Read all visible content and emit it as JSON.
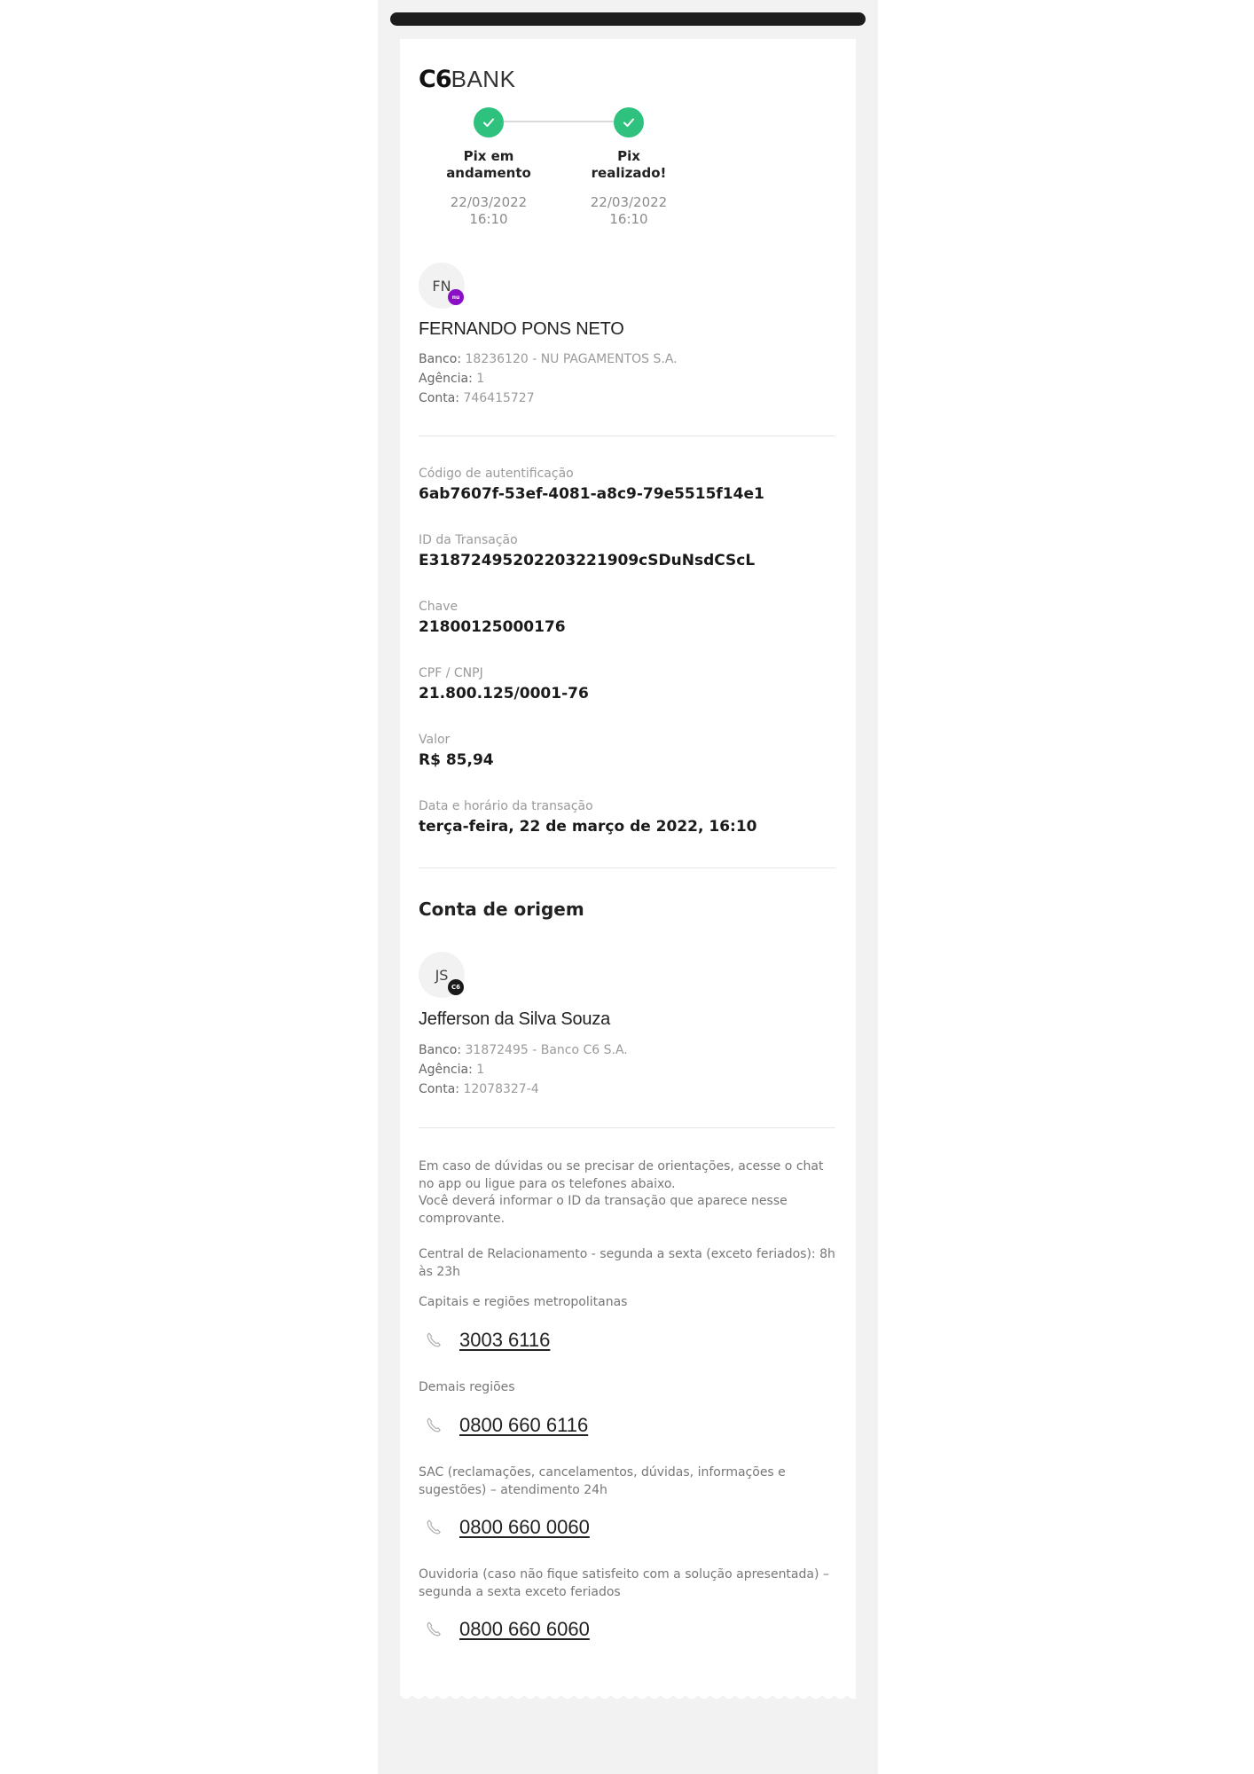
{
  "brand": {
    "mark": "C6",
    "word": "BANK"
  },
  "steps": [
    {
      "title": "Pix em\nandamento",
      "date": "22/03/2022\n16:10"
    },
    {
      "title": "Pix\nrealizado!",
      "date": "22/03/2022\n16:10"
    }
  ],
  "recipient": {
    "initials": "FN",
    "badge": "nu",
    "name": "FERNANDO PONS NETO",
    "banco_label": "Banco:",
    "banco": "18236120 - NU PAGAMENTOS S.A.",
    "agencia_label": "Agência:",
    "agencia": "1",
    "conta_label": "Conta:",
    "conta": "746415727"
  },
  "details": [
    {
      "label": "Código de autentificação",
      "value": "6ab7607f-53ef-4081-a8c9-79e5515f14e1"
    },
    {
      "label": "ID da Transação",
      "value": "E31872495202203221909cSDuNsdCScL"
    },
    {
      "label": "Chave",
      "value": "21800125000176"
    },
    {
      "label": "CPF / CNPJ",
      "value": "21.800.125/0001-76"
    },
    {
      "label": "Valor",
      "value": "R$ 85,94"
    },
    {
      "label": "Data e horário da transação",
      "value": "terça-feira, 22 de março de 2022, 16:10"
    }
  ],
  "origin": {
    "section_title": "Conta de origem",
    "initials": "JS",
    "badge": "C6",
    "name": "Jefferson da Silva Souza",
    "banco_label": "Banco:",
    "banco": "31872495 - Banco C6 S.A.",
    "agencia_label": "Agência:",
    "agencia": "1",
    "conta_label": "Conta:",
    "conta": "12078327-4"
  },
  "help": {
    "intro": "Em caso de dúvidas ou se precisar de orientações, acesse o chat no app ou ligue para os telefones abaixo.\nVocê deverá informar o ID da transação que aparece nesse comprovante.",
    "central": "Central de Relacionamento - segunda a sexta (exceto feriados): 8h às 23h",
    "phones": [
      {
        "label": "Capitais e regiões metropolitanas",
        "number": "3003 6116"
      },
      {
        "label": "Demais regiões",
        "number": "0800 660 6116"
      },
      {
        "label": "SAC (reclamações, cancelamentos, dúvidas, informações e sugestões) – atendimento 24h",
        "number": "0800 660 0060"
      },
      {
        "label": "Ouvidoria (caso não fique satisfeito com a solução apresentada) – segunda a sexta exceto feriados",
        "number": "0800 660 6060"
      }
    ]
  },
  "colors": {
    "success": "#2ec27e",
    "nu_purple": "#8a0fc7",
    "c6_black": "#1a1a1a"
  },
  "icons": {
    "step_done": "check-icon",
    "phone": "phone-icon"
  }
}
